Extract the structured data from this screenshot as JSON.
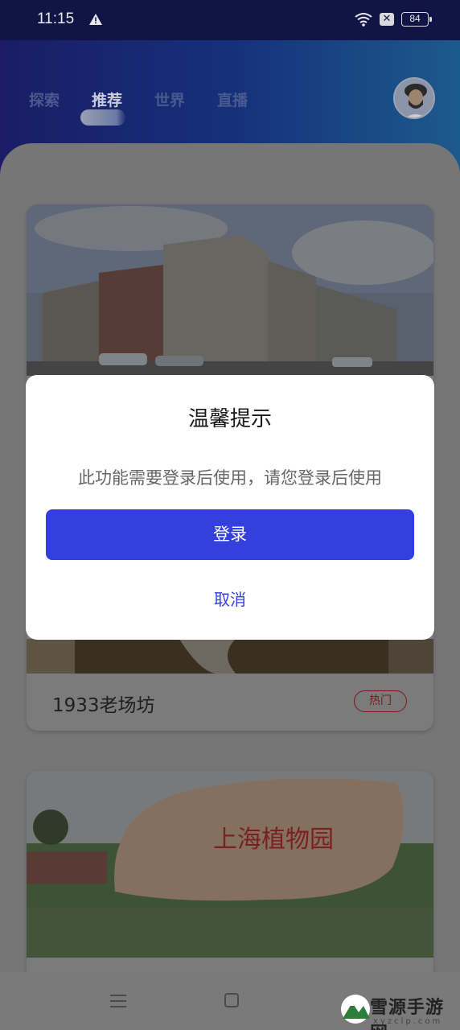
{
  "status_bar": {
    "time": "11:15",
    "battery": "84",
    "icons": [
      "warning-icon",
      "wifi-icon",
      "close-box-icon",
      "battery-icon"
    ]
  },
  "header": {
    "tabs": [
      {
        "label": "探索",
        "active": false
      },
      {
        "label": "推荐",
        "active": true
      },
      {
        "label": "世界",
        "active": false
      },
      {
        "label": "直播",
        "active": false
      }
    ]
  },
  "cards": [
    {
      "caption": "1933老场坊",
      "badge": "热门"
    },
    {
      "caption": ""
    }
  ],
  "dialog": {
    "title": "温馨提示",
    "message": "此功能需要登录后使用，请您登录后使用",
    "confirm_label": "登录",
    "cancel_label": "取消"
  },
  "nav_bar": {
    "icons": [
      "menu-icon",
      "home-icon",
      "back-icon"
    ]
  },
  "watermark": {
    "text": "雪源手游网",
    "sub": "xyzclp.com"
  },
  "colors": {
    "accent": "#3340de",
    "header_start": "#1a1d66",
    "header_end": "#1c5a8c",
    "badge": "#d03030"
  }
}
